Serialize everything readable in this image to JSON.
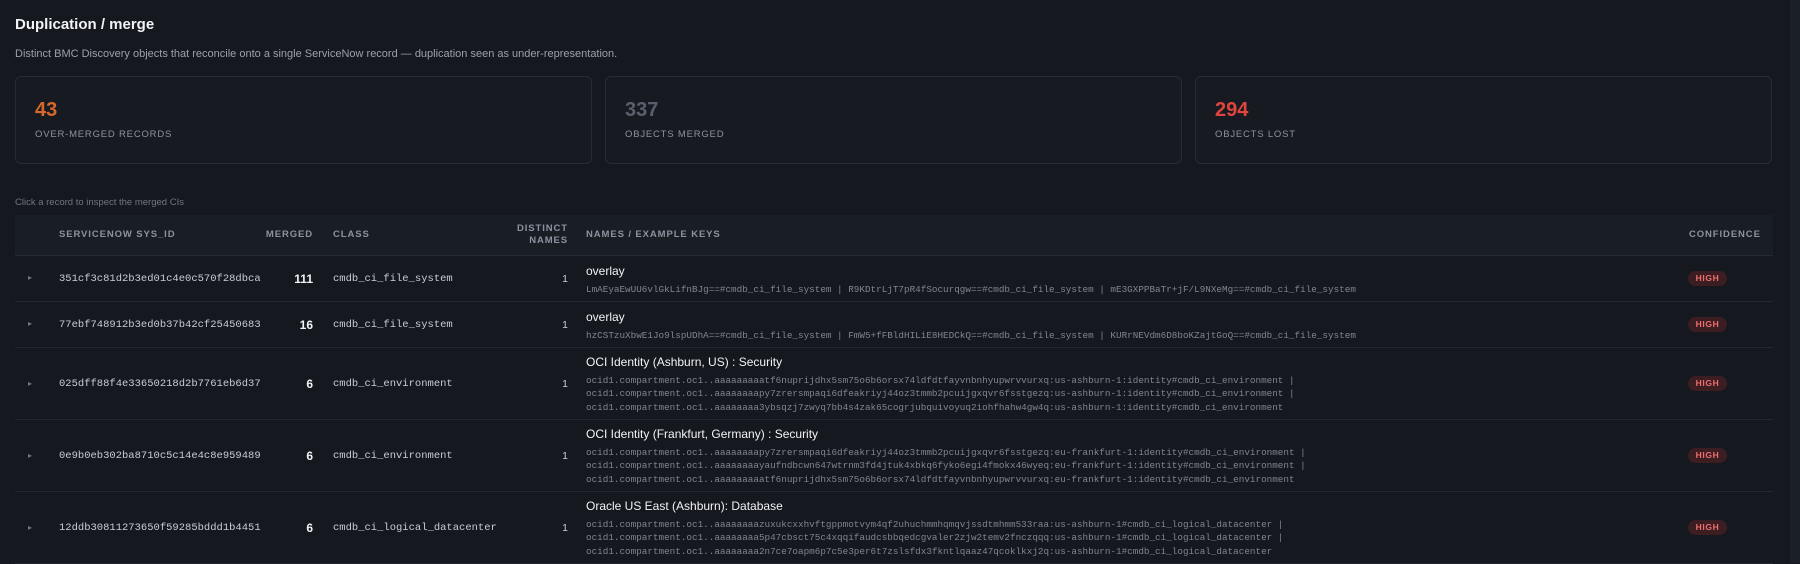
{
  "page": {
    "title": "Duplication / merge",
    "subtitle": "Distinct BMC Discovery objects that reconcile onto a single ServiceNow record — duplication seen as under-representation."
  },
  "stats": [
    {
      "value": "43",
      "label": "OVER-MERGED RECORDS",
      "color": "#d8672b"
    },
    {
      "value": "337",
      "label": "OBJECTS MERGED",
      "color": "#59606c"
    },
    {
      "value": "294",
      "label": "OBJECTS LOST",
      "color": "#e0443d"
    }
  ],
  "hint": "Click a record to inspect the merged CIs",
  "table": {
    "headers": {
      "sys_id": "SERVICENOW SYS_ID",
      "merged": "MERGED",
      "class": "CLASS",
      "distinct_line1": "DISTINCT",
      "distinct_line2": "NAMES",
      "names": "NAMES / EXAMPLE KEYS",
      "confidence": "CONFIDENCE"
    },
    "rows": [
      {
        "caret": "▸",
        "sys_id": "351cf3c81d2b3ed01c4e0c570f28dbca",
        "merged": "111",
        "class": "cmdb_ci_file_system",
        "distinct": "1",
        "name": "overlay",
        "keys": "LmAEyaEwUU6vlGkLifnBJg==#cmdb_ci_file_system | R9KDtrLjT7pR4fSocurqgw==#cmdb_ci_file_system | mE3GXPPBaTr+jF/L9NXeMg==#cmdb_ci_file_system",
        "confidence": "HIGH"
      },
      {
        "caret": "▸",
        "sys_id": "77ebf748912b3ed0b37b42cf25450683",
        "merged": "16",
        "class": "cmdb_ci_file_system",
        "distinct": "1",
        "name": "overlay",
        "keys": "hzCSTzuXbwE1Jo9lspUDhA==#cmdb_ci_file_system | FmW5+fFBldHILiE8HEDCkQ==#cmdb_ci_file_system | KURrNEVdm6D8boKZajtGoQ==#cmdb_ci_file_system",
        "confidence": "HIGH"
      },
      {
        "caret": "▸",
        "sys_id": "025dff88f4e33650218d2b7761eb6d37",
        "merged": "6",
        "class": "cmdb_ci_environment",
        "distinct": "1",
        "name": "OCI Identity (Ashburn, US) : Security",
        "keys": "ocid1.compartment.oc1..aaaaaaaaatf6nuprijdhx5sm75o6b6orsx74ldfdtfayvnbnhyupwrvvurxq:us-ashburn-1:identity#cmdb_ci_environment |\nocid1.compartment.oc1..aaaaaaaapy7zrersmpaqi6dfeakriyj44oz3tmmb2pcuijgxqvr6fsstgezq:us-ashburn-1:identity#cmdb_ci_environment |\nocid1.compartment.oc1..aaaaaaaa3ybsqzj7zwyq7bb4s4zak65cogrjubquivoyuq2iohfhahw4gw4q:us-ashburn-1:identity#cmdb_ci_environment",
        "confidence": "HIGH"
      },
      {
        "caret": "▸",
        "sys_id": "0e9b0eb302ba8710c5c14e4c8e959489",
        "merged": "6",
        "class": "cmdb_ci_environment",
        "distinct": "1",
        "name": "OCI Identity (Frankfurt, Germany) : Security",
        "keys": "ocid1.compartment.oc1..aaaaaaaapy7zrersmpaqi6dfeakriyj44oz3tmmb2pcuijgxqvr6fsstgezq:eu-frankfurt-1:identity#cmdb_ci_environment |\nocid1.compartment.oc1..aaaaaaaayaufndbcwn647wtrnm3fd4jtuk4xbkq6fyko6egi4fmokx46wyeq:eu-frankfurt-1:identity#cmdb_ci_environment |\nocid1.compartment.oc1..aaaaaaaaatf6nuprijdhx5sm75o6b6orsx74ldfdtfayvnbnhyupwrvvurxq:eu-frankfurt-1:identity#cmdb_ci_environment",
        "confidence": "HIGH"
      },
      {
        "caret": "▸",
        "sys_id": "12ddb30811273650f59285bddd1b4451",
        "merged": "6",
        "class": "cmdb_ci_logical_datacenter",
        "distinct": "1",
        "name": "Oracle US East (Ashburn): Database",
        "keys": "ocid1.compartment.oc1..aaaaaaaazuxukcxxhvftgppmotvym4qf2uhuchmmhqmqvjssdtmhmm533raa:us-ashburn-1#cmdb_ci_logical_datacenter |\nocid1.compartment.oc1..aaaaaaaa5p47cbsct75c4xqqifaudcsbbqedcgvaler2zjw2temv2fnczqqq:us-ashburn-1#cmdb_ci_logical_datacenter |\nocid1.compartment.oc1..aaaaaaaa2n7ce7oapm6p7c5e3per6t7zslsfdx3fkntlqaaz47qcoklkxj2q:us-ashburn-1#cmdb_ci_logical_datacenter",
        "confidence": "HIGH"
      }
    ]
  }
}
